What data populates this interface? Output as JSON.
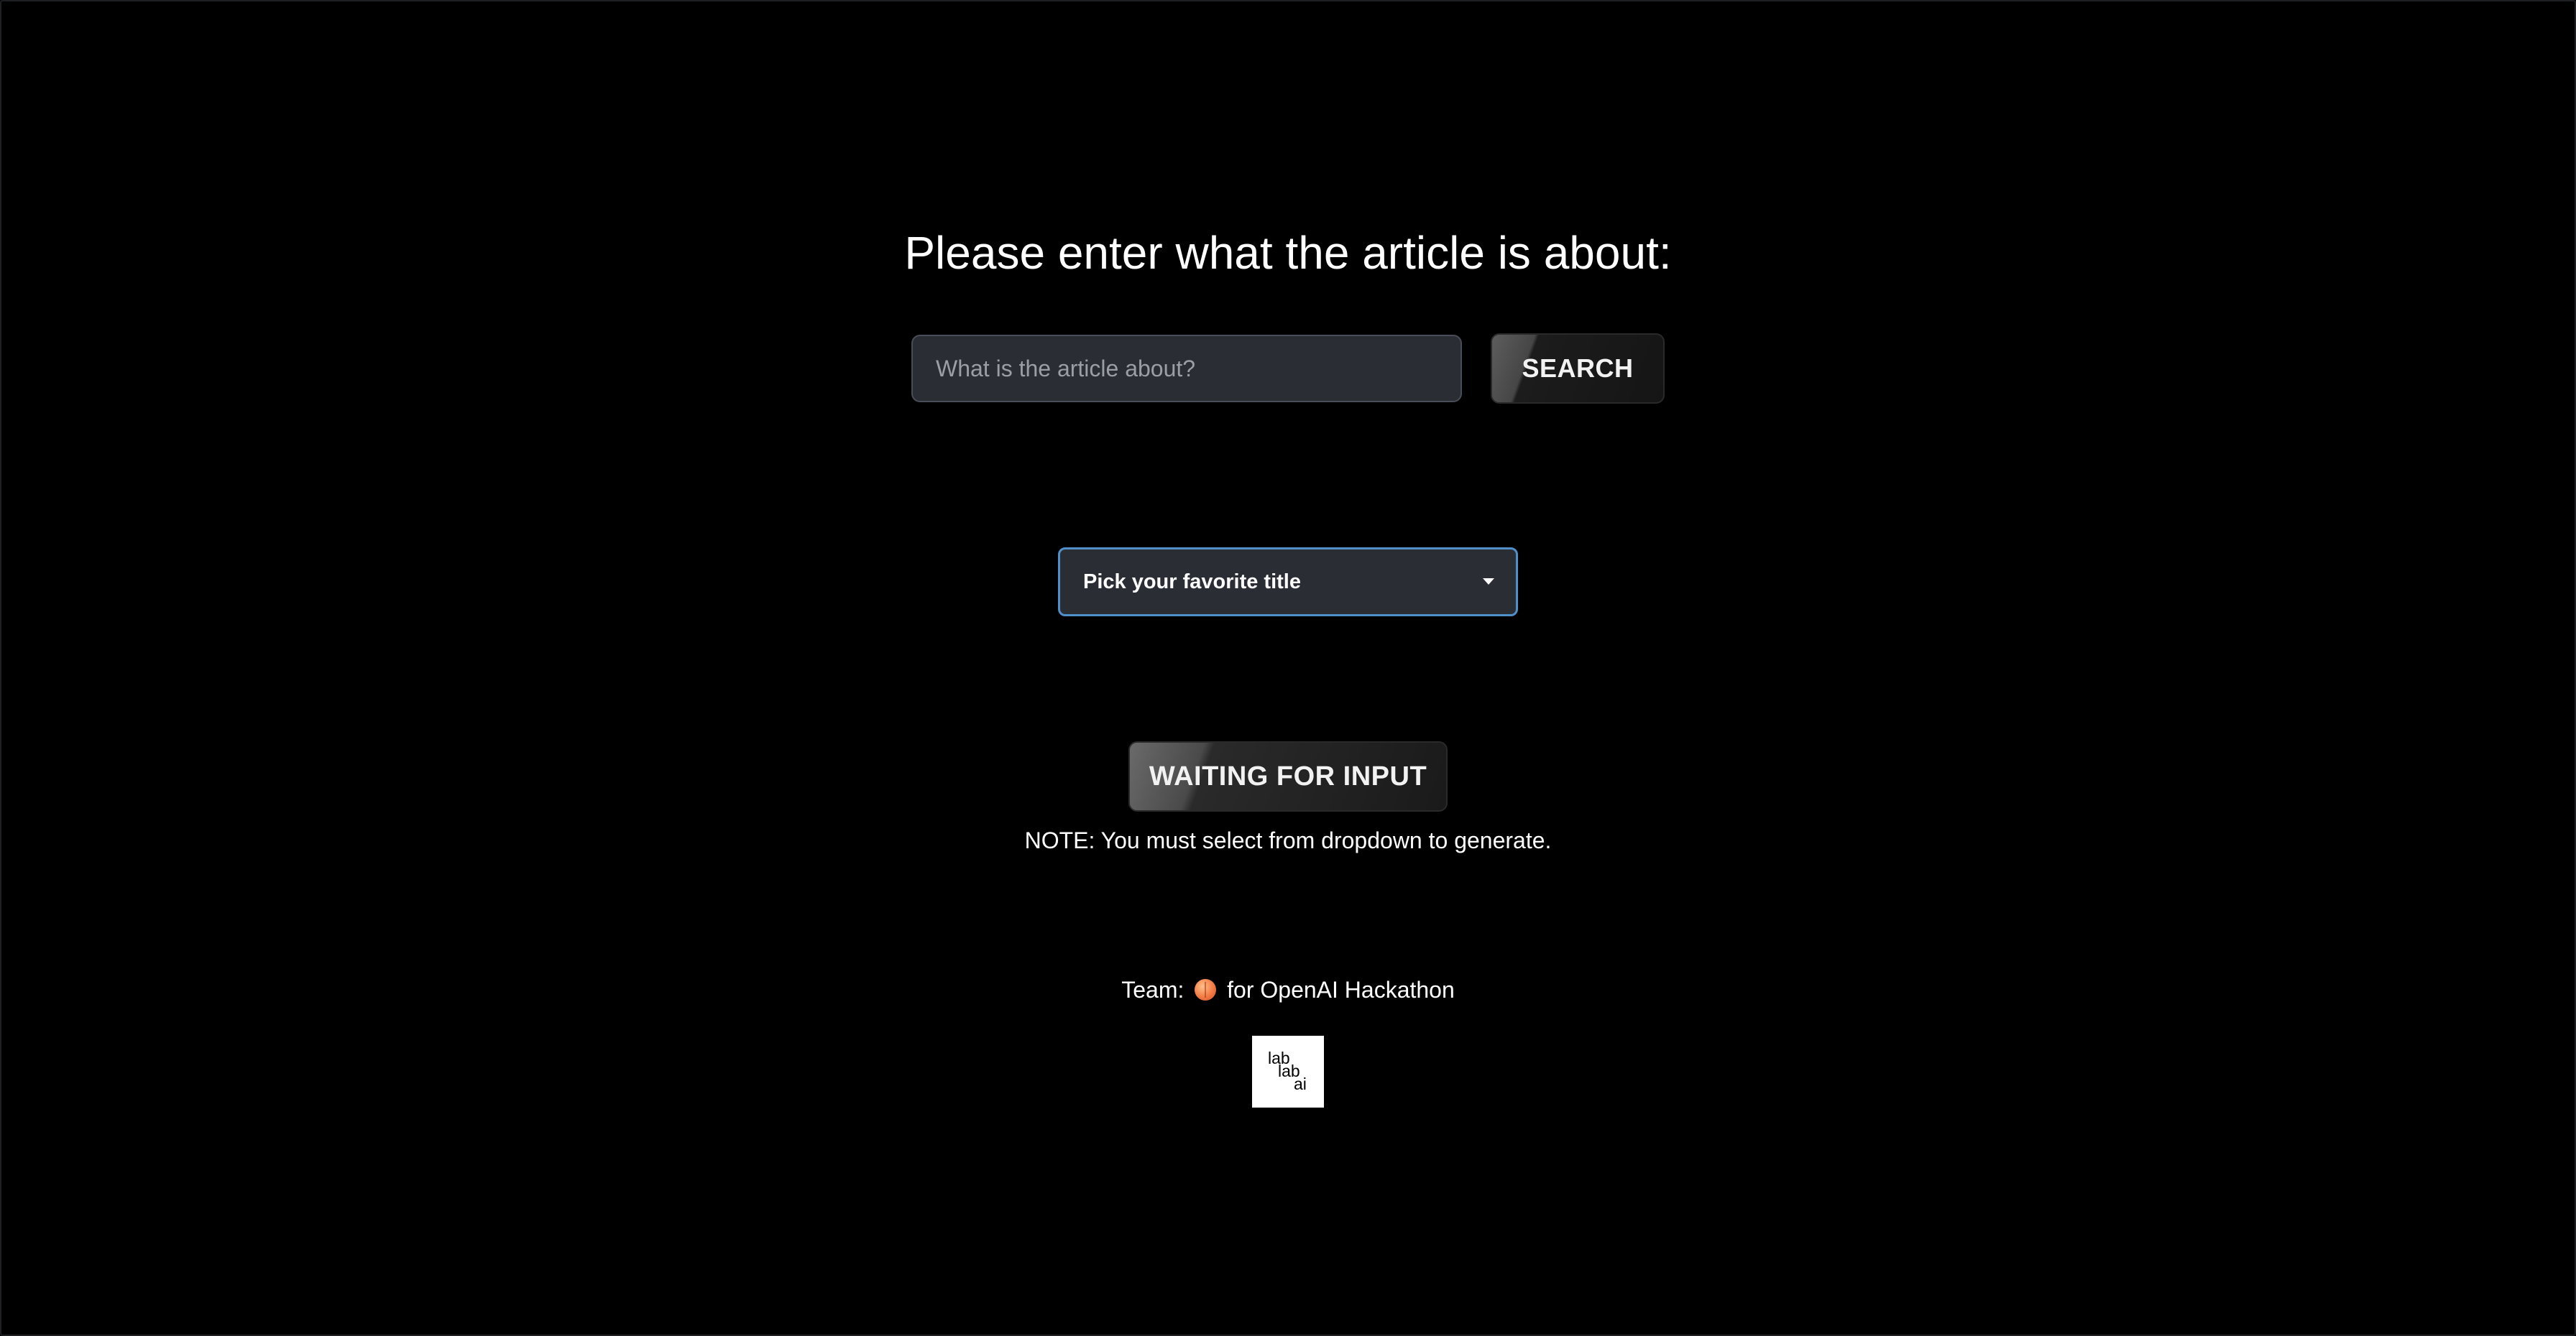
{
  "heading": "Please enter what the article is about:",
  "search": {
    "placeholder": "What is the article about?",
    "value": "",
    "button_label": "SEARCH"
  },
  "title_select": {
    "selected": "Pick your favorite title",
    "icon": "chevron-down-icon"
  },
  "generate": {
    "button_label": "WAITING FOR INPUT"
  },
  "note": "NOTE: You must select from dropdown to generate.",
  "footer": {
    "team_prefix": "Team:",
    "team_emoji": "🍑",
    "team_suffix": "for OpenAI Hackathon",
    "logo_lines": [
      "lab",
      "lab",
      "ai"
    ]
  },
  "colors": {
    "background": "#000000",
    "field": "#2a2d34",
    "select_border": "#4f90c8",
    "text": "#ffffff"
  }
}
